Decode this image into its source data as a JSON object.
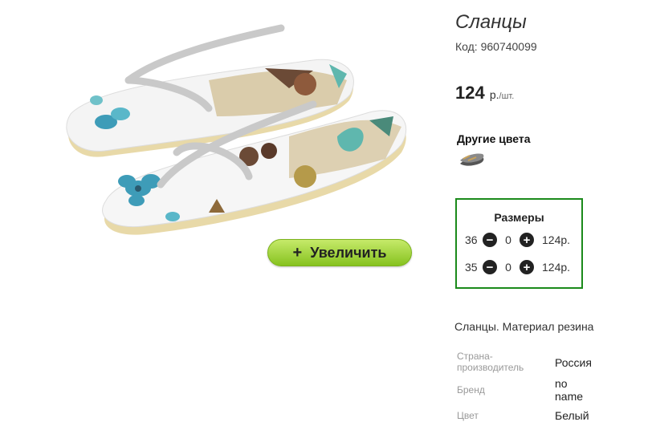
{
  "product": {
    "title": "Сланцы",
    "code": "Код: 960740099",
    "price_value": "124",
    "price_currency": "р.",
    "price_unit": "/шт.",
    "zoom_button": {
      "icon": "+",
      "label": "Увеличить"
    }
  },
  "other_colors": {
    "label": "Другие цвета"
  },
  "sizes": {
    "title": "Размеры",
    "rows": [
      {
        "size": "36",
        "qty": "0",
        "price": "124р."
      },
      {
        "size": "35",
        "qty": "0",
        "price": "124р."
      }
    ]
  },
  "description": "Сланцы. Материал резина",
  "specs": [
    {
      "label": "Страна-производитель",
      "value": "Россия"
    },
    {
      "label": "Бренд",
      "value": "no name"
    },
    {
      "label": "Цвет",
      "value": "Белый"
    }
  ],
  "colors": {
    "accent_border": "#1b8a1b",
    "button_green": "#8cc63f"
  }
}
